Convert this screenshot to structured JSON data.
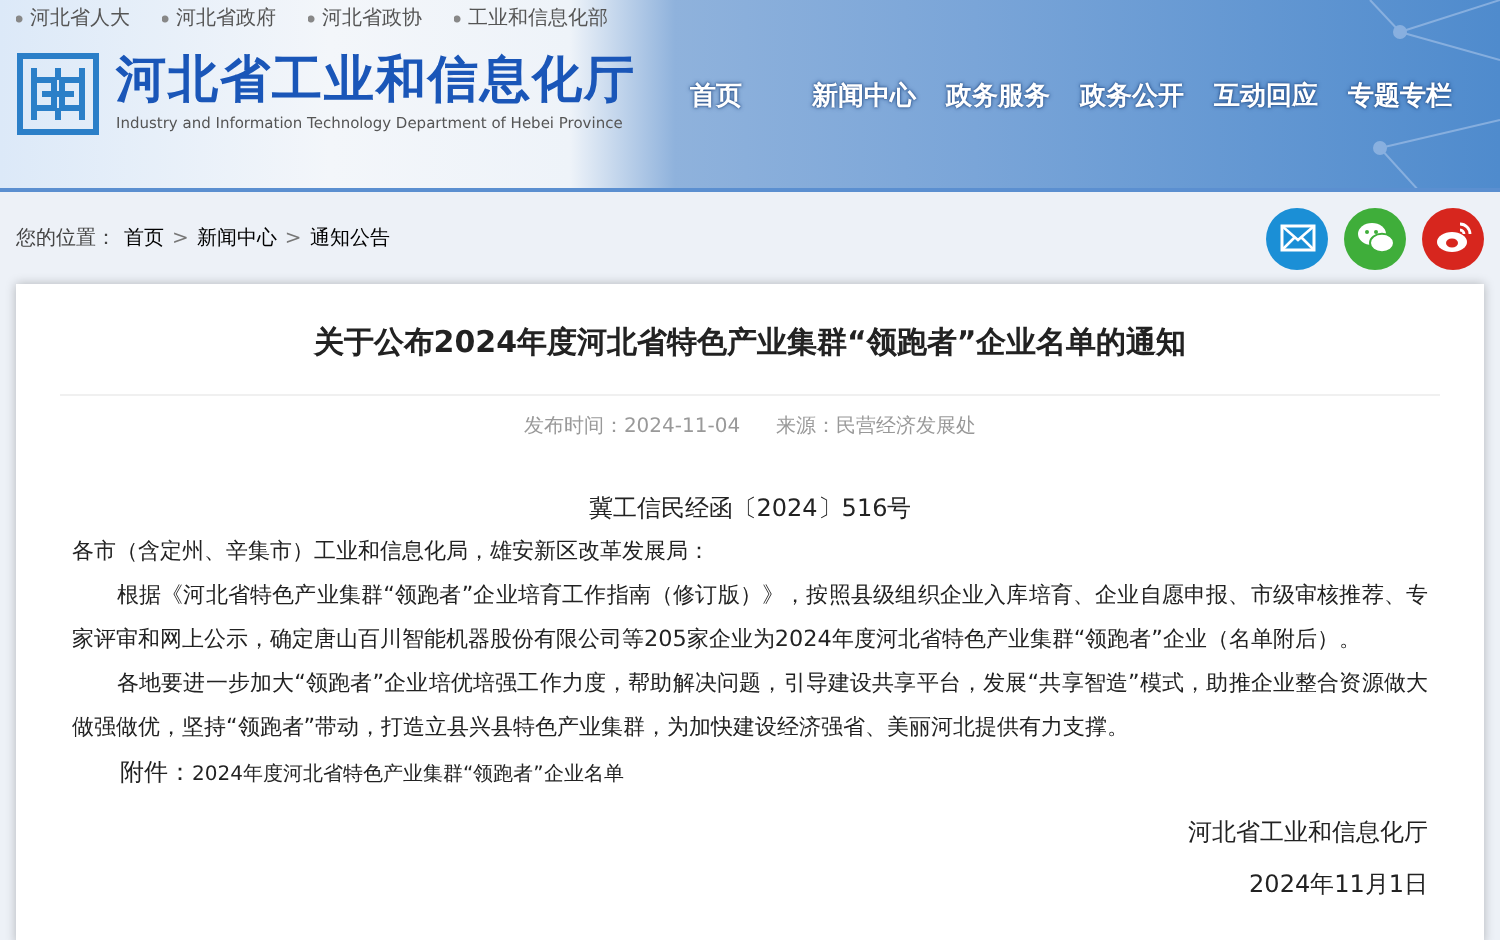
{
  "top_links": [
    "河北省人大",
    "河北省政府",
    "河北省政协",
    "工业和信息化部"
  ],
  "logo": {
    "title": "河北省工业和信息化厅",
    "subtitle": "Industry and Information Technology Department of Hebei Province"
  },
  "nav": [
    "首页",
    "新闻中心",
    "政务服务",
    "政务公开",
    "互动回应",
    "专题专栏"
  ],
  "breadcrumb": [
    {
      "kind": "label",
      "text": "您的位置："
    },
    {
      "kind": "link",
      "text": "首页"
    },
    {
      "kind": "sep",
      "text": ">"
    },
    {
      "kind": "link",
      "text": "新闻中心"
    },
    {
      "kind": "sep",
      "text": ">"
    },
    {
      "kind": "link",
      "text": "通知公告"
    }
  ],
  "share": [
    {
      "kind": "mail"
    },
    {
      "kind": "wechat"
    },
    {
      "kind": "weibo"
    }
  ],
  "article": {
    "title": "关于公布2024年度河北省特色产业集群“领跑者”企业名单的通知",
    "meta": [
      "发布时间：2024-11-04",
      "来源：民营经济发展处"
    ],
    "doc_number": "冀工信民经函〔2024〕516号",
    "salutation": "各市（含定州、辛集市）工业和信息化局，雄安新区改革发展局：",
    "paragraphs": [
      "根据《河北省特色产业集群“领跑者”企业培育工作指南（修订版）》，按照县级组织企业入库培育、企业自愿申报、市级审核推荐、专家评审和网上公示，确定唐山百川智能机器股份有限公司等205家企业为2024年度河北省特色产业集群“领跑者”企业（名单附后）。",
      "各地要进一步加大“领跑者”企业培优培强工作力度，帮助解决问题，引导建设共享平台，发展“共享智造”模式，助推企业整合资源做大做强做优，坚持“领跑者”带动，打造立县兴县特色产业集群，为加快建设经济强省、美丽河北提供有力支撑。"
    ],
    "attachment": {
      "label": "附件：",
      "link": "2024年度河北省特色产业集群“领跑者”企业名单"
    },
    "signature": {
      "org": "河北省工业和信息化厅",
      "date": "2024年11月1日"
    }
  }
}
